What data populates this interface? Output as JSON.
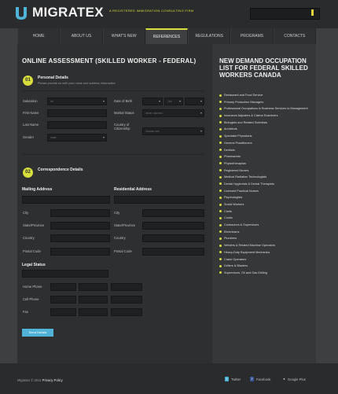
{
  "brand": {
    "name": "MIGRATEX",
    "tagline": "A REGISTERED IMMIGRATION CONSULTING FIRM",
    "accent": "#d8de3c"
  },
  "search": {
    "placeholder": ""
  },
  "nav": [
    {
      "label": "HOME"
    },
    {
      "label": "ABOUT US"
    },
    {
      "label": "WHAT'S NEW"
    },
    {
      "label": "REFERENCES",
      "active": true
    },
    {
      "label": "REGULATIONS"
    },
    {
      "label": "PROGRAMS"
    },
    {
      "label": "CONTACTS"
    }
  ],
  "form": {
    "title": "ONLINE ASSESSMENT (SKILLED WORKER - FEDERAL)",
    "step1": {
      "number": "01",
      "title": "Personal Details",
      "subtitle": "Please provide us with your name and address information",
      "salutation_label": "Salutation",
      "salutation_value": "mr",
      "first_name_label": "First Name",
      "last_name_label": "Last Name",
      "gender_label": "Gender",
      "gender_value": "male",
      "dob_label": "Date of Birth",
      "dob_day": "",
      "dob_month": "Jan",
      "dob_year": "",
      "marital_label": "Marital Status",
      "marital_value": "never married",
      "citizenship_label": "Country of Citizenship",
      "citizenship_value": "choose one"
    },
    "step2": {
      "number": "02",
      "title": "Correspondence Details",
      "mailing_label": "Mailing Address",
      "residential_label": "Residential Address",
      "city_label": "City",
      "state_label": "State/Province",
      "country_label": "Country",
      "postal_label": "Postal Code",
      "legal_label": "Legal Status",
      "home_phone_label": "Home Phone",
      "cell_phone_label": "Cell Phone",
      "fax_label": "Fax"
    },
    "send_label": "Send Details"
  },
  "sidebar": {
    "title": "NEW DEMAND OCCUPATION LIST FOR FEDERAL SKILLED WORKERS CANADA",
    "items": [
      "Restaurant and Food Service",
      "Primary Production Managers",
      "Professional Occupations in Business Services to Management",
      "Insurance Adjusters & Claims Examiners",
      "Biologists and Related Scientists",
      "Architects",
      "Specialist Physicians",
      "General Practitioners",
      "Dentists",
      "Pharmacists",
      "Physiotherapists",
      "Registered Nurses",
      "Medical Radiation Technologists",
      "Dental Hygienists & Dental Therapists",
      "Licensed Practical Nurses",
      "Psychologists",
      "Social Workers",
      "Chefs",
      "Cooks",
      "Contractors & Supervisors",
      "Electricians",
      "Plumbers",
      "Welders & Related Machine Operators",
      "Heavy-Duty Equipment Mechanics",
      "Crane Operators",
      "Drillers & Blasters",
      "Supervisors, Oil and Gas Drilling"
    ]
  },
  "footer": {
    "copyright": "Migratex © 2011",
    "privacy": "Privacy Policy",
    "twitter": "Twitter",
    "facebook": "Facebook",
    "googleplus": "Google Plus"
  }
}
